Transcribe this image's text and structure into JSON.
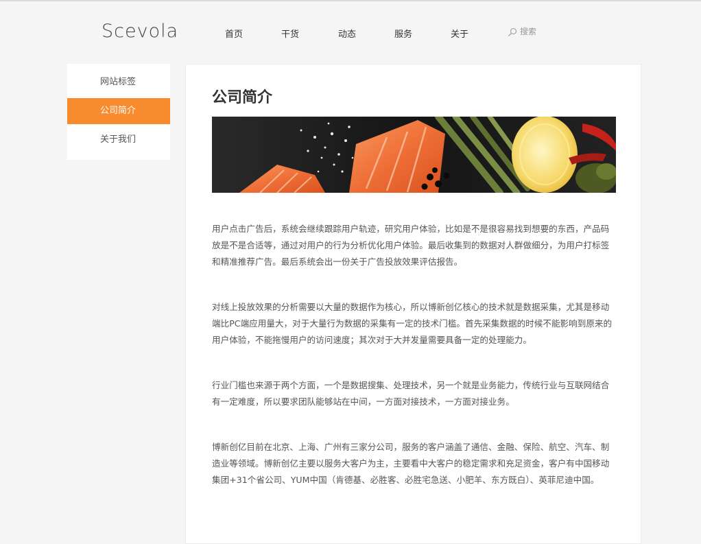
{
  "header": {
    "logo": "Scevola",
    "nav": [
      "首页",
      "干货",
      "动态",
      "服务",
      "关于"
    ],
    "search_placeholder": "搜索"
  },
  "sidebar": {
    "items": [
      {
        "label": "网站标签",
        "active": false
      },
      {
        "label": "公司简介",
        "active": true
      },
      {
        "label": "关于我们",
        "active": false
      }
    ]
  },
  "main": {
    "title": "公司简介",
    "banner": "salmon-food-banner",
    "paragraphs": [
      "用户点击广告后，系统会继续跟踪用户轨迹，研究用户体验，比如是不是很容易找到想要的东西，产品码放是不是合适等，通过对用户的行为分析优化用户体验。最后收集到的数据对人群做细分，为用户打标签和精准推荐广告。最后系统会出一份关于广告投放效果评估报告。",
      "对线上投放效果的分析需要以大量的数据作为核心，所以博新创亿核心的技术就是数据采集，尤其是移动端比PC端应用量大，对于大量行为数据的采集有一定的技术门槛。首先采集数据的时候不能影响到原来的用户体验，不能拖慢用户的访问速度；其次对于大并发量需要具备一定的处理能力。",
      "行业门槛也来源于两个方面，一个是数据搜集、处理技术，另一个就是业务能力，传统行业与互联网结合有一定难度，所以要求团队能够站在中间，一方面对接技术，一方面对接业务。",
      "博新创亿目前在北京、上海、广州有三家分公司，服务的客户涵盖了通信、金融、保险、航空、汽车、制造业等领域。博新创亿主要以服务大客户为主，主要看中大客户的稳定需求和充足资金，客户有中国移动集团+31个省公司、YUM中国（肯德基、必胜客、必胜宅急送、小肥羊、东方既白）、英菲尼迪中国。"
    ]
  },
  "colors": {
    "accent": "#f98b2f",
    "background": "#f5f5f5",
    "card": "#ffffff"
  }
}
